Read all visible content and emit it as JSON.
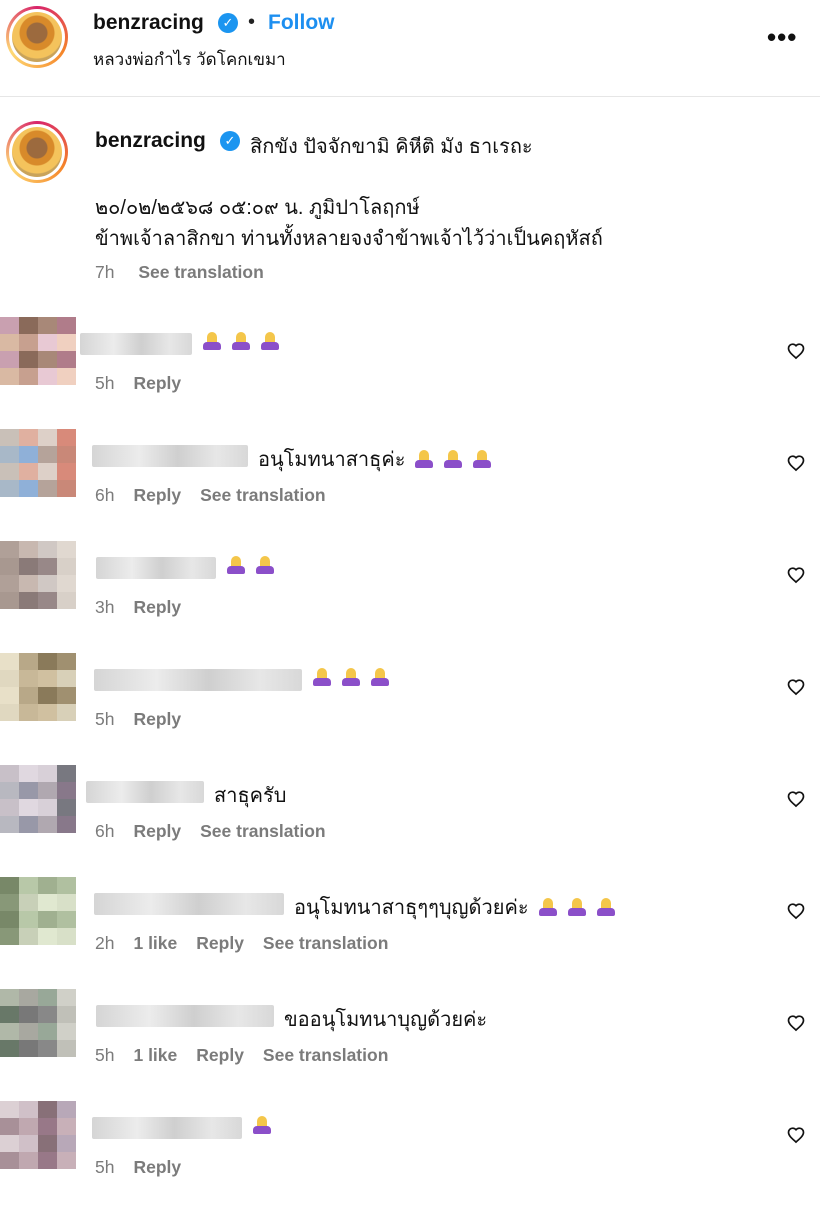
{
  "post": {
    "username": "benzracing",
    "follow_label": "Follow",
    "separator": "•",
    "subtitle": "หลวงพ่อกำไร วัดโคกเขมา",
    "more_label": "•••"
  },
  "caption": {
    "username": "benzracing",
    "line1": "สิกขัง ปัจจักขามิ คิหีติ มัง ธาเรถะ",
    "line2": "๒๐/๐๒/๒๕๖๘ ๐๕:๐๙ น. ภูมิปาโลฤกษ์",
    "line3": "ข้าพเจ้าลาสิกขา ท่านทั้งหลายจงจำข้าพเจ้าไว้ว่าเป็นคฤหัสถ์",
    "time": "7h",
    "see_translation": "See translation"
  },
  "comments": [
    {
      "text": "",
      "emoji_count": 3,
      "time": "5h",
      "likes": "",
      "reply": "Reply",
      "see_translation": ""
    },
    {
      "text": "อนุโมทนาสาธุค่ะ",
      "emoji_count": 3,
      "time": "6h",
      "likes": "",
      "reply": "Reply",
      "see_translation": "See translation"
    },
    {
      "text": "",
      "emoji_count": 2,
      "time": "3h",
      "likes": "",
      "reply": "Reply",
      "see_translation": ""
    },
    {
      "text": "",
      "emoji_count": 3,
      "time": "5h",
      "likes": "",
      "reply": "Reply",
      "see_translation": ""
    },
    {
      "text": "สาธุครับ",
      "emoji_count": 0,
      "time": "6h",
      "likes": "",
      "reply": "Reply",
      "see_translation": "See translation"
    },
    {
      "text": "อนุโมทนาสาธุๆๆบุญด้วยค่ะ",
      "emoji_count": 3,
      "time": "2h",
      "likes": "1 like",
      "reply": "Reply",
      "see_translation": "See translation"
    },
    {
      "text": "ขออนุโมทนาบุญด้วยค่ะ",
      "emoji_count": 0,
      "time": "5h",
      "likes": "1 like",
      "reply": "Reply",
      "see_translation": "See translation"
    },
    {
      "text": "",
      "emoji_count": 1,
      "time": "5h",
      "likes": "",
      "reply": "Reply",
      "see_translation": ""
    }
  ]
}
